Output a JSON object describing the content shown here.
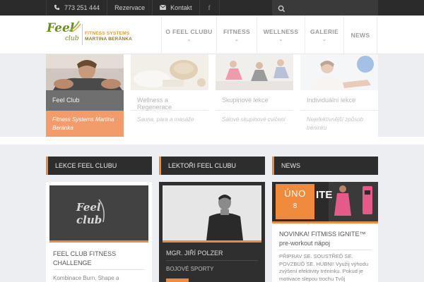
{
  "topbar": {
    "phone_icon": "phone-icon",
    "phone": "773 251 444",
    "reservation": "Rezervace",
    "contact_icon": "envelope-icon",
    "contact": "Kontakt",
    "social_icon": "facebook-icon",
    "social": "f",
    "search_icon": "search-icon"
  },
  "logo": {
    "feel": "Feel",
    "club": "club",
    "line1": "FITNESS SYSTEMS",
    "line2": "MARTINA BERÁNKA"
  },
  "nav": [
    {
      "label": "O FEEL CLUBU",
      "chevron": "⌄"
    },
    {
      "label": "FITNESS",
      "chevron": "⌄"
    },
    {
      "label": "WELLNESS",
      "chevron": "⌄"
    },
    {
      "label": "GALERIE",
      "chevron": "⌄"
    },
    {
      "label": "NEWS",
      "chevron": ""
    }
  ],
  "tiles": [
    {
      "title": "Feel Club",
      "sub": "Fitness Systems Martina Beránka",
      "active": true
    },
    {
      "title": "Wellness a Regenerace",
      "sub": "Sauna, pára a masáže",
      "active": false
    },
    {
      "title": "Skupinové lekce",
      "sub": "Sálové skupinové cvičení",
      "active": false
    },
    {
      "title": "Individuální lekce",
      "sub": "Nejefektivnější způsob tréninku",
      "active": false
    }
  ],
  "columns": {
    "lessons": {
      "heading": "LEKCE FEEL CLUBU",
      "image_text": "Feel club",
      "title": "FEEL CLUB FITNESS CHALLENGE",
      "text": "Kombinace Burn, Shape a"
    },
    "trainers": {
      "heading": "LEKTOŘI FEEL CLUBU",
      "name": "MGR. JIŘÍ POLZER",
      "role": "BOJOVÉ SPORTY"
    },
    "news": {
      "heading": "NEWS",
      "month": "ÚNO",
      "day": "8",
      "banner_text": "ITE",
      "title": "NOVINKA! FITMISS IGNITE™ pre-workout nápoj",
      "text": "PŘIPRAV SE. SOUSTŘEĎ SE. POVZBUĎ SE. HUBNI! Využij výhodu zvýšení efektivity tréninku. Pokud je motivace slepou trochu Tvůj"
    }
  },
  "colors": {
    "accent": "#f08a3c",
    "dark": "#2d2d2d",
    "logo_green": "#6e8a2a"
  }
}
